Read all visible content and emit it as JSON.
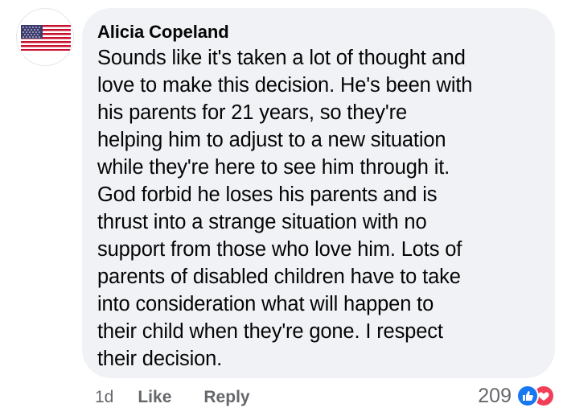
{
  "comment": {
    "author": "Alicia Copeland",
    "avatar_icon": "us-flag-icon",
    "text": "Sounds like it's taken a lot of thought and\nlove to make this decision. He's been with\nhis parents for 21 years, so they're\nhelping him to adjust to a new situation\nwhile they're here to see him through it.\nGod forbid he loses his parents and is\nthrust into a strange situation with no\nsupport from those who love him. Lots of\nparents of disabled children have to take\ninto consideration what will happen to\ntheir child when they're gone. I respect\ntheir decision."
  },
  "actions": {
    "time": "1d",
    "like_label": "Like",
    "reply_label": "Reply"
  },
  "reactions": {
    "count": "209",
    "icons": [
      "like-reaction-icon",
      "love-reaction-icon"
    ],
    "like_color": "#1877f2",
    "love_color": "#f33e58"
  }
}
